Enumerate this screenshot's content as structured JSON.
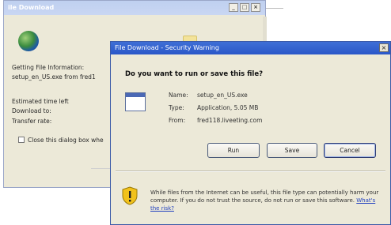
{
  "background_window": {
    "title": "ile Download",
    "getting_info": "Getting File Information:",
    "file_line": "setup_en_US.exe from fred1",
    "estimated_time": "Estimated time left",
    "download_to": "Download to:",
    "transfer_rate": "Transfer rate:",
    "close_checkbox_label": "Close this dialog box whe"
  },
  "dialog": {
    "title": "File Download - Security Warning",
    "close_glyph": "×",
    "question": "Do you want to run or save this file?",
    "info": {
      "name_label": "Name:",
      "name_value": "setup_en_US.exe",
      "type_label": "Type:",
      "type_value": "Application, 5.05 MB",
      "from_label": "From:",
      "from_value": "fred118.liveeting.com"
    },
    "buttons": {
      "run": "Run",
      "save": "Save",
      "cancel": "Cancel"
    },
    "warning": {
      "text": "While files from the Internet can be useful, this file type can potentially harm your computer. If you do not trust the source, do not run or save this software.",
      "link": "What's the risk?"
    }
  },
  "colors": {
    "dialog_titlebar": "#2a57c8",
    "background_titlebar": "#c9d6f2",
    "window_face": "#ece9d8",
    "link": "#1f3fbf"
  },
  "icons": [
    "globe-icon",
    "folder-icon",
    "file-icon",
    "shield-warning-icon",
    "close-icon"
  ]
}
